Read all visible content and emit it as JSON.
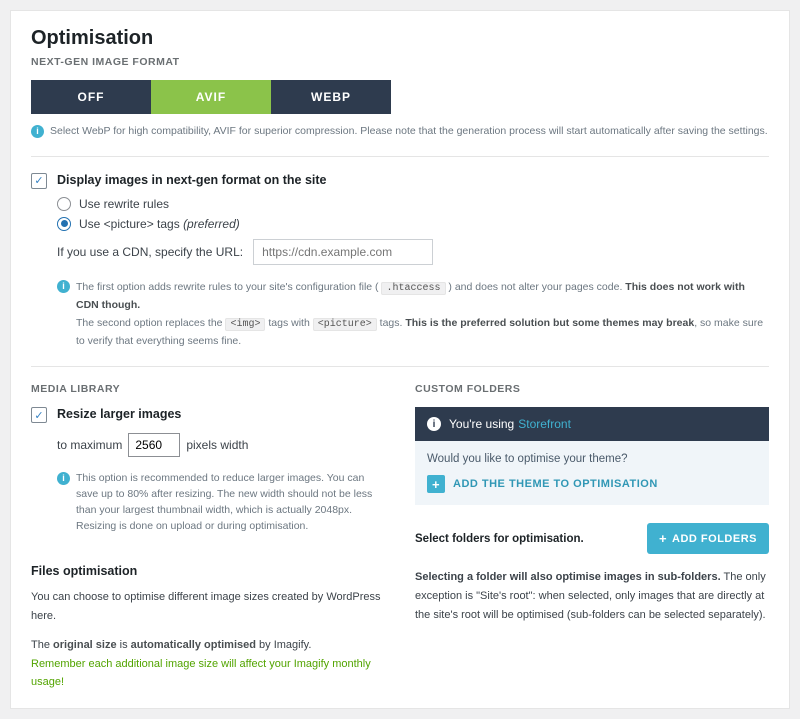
{
  "header": {
    "title": "Optimisation",
    "section": "NEXT-GEN IMAGE FORMAT"
  },
  "tabs": {
    "off": "OFF",
    "avif": "AVIF",
    "webp": "WEBP"
  },
  "format_info": "Select WebP for high compatibility, AVIF for superior compression. Please note that the generation process will start automatically after saving the settings.",
  "display": {
    "label": "Display images in next-gen format on the site",
    "radio_rewrite": "Use rewrite rules",
    "radio_picture_pre": "Use <picture> tags ",
    "radio_picture_suf": "(preferred)",
    "cdn_label": "If you use a CDN, specify the URL:",
    "cdn_placeholder": "https://cdn.example.com",
    "note1_a": "The first option adds rewrite rules to your site's configuration file ( ",
    "note1_code": ".htaccess",
    "note1_b": " ) and does not alter your pages code. ",
    "note1_bold": "This does not work with CDN though.",
    "note2_a": "The second option replaces the ",
    "note2_code1": "<img>",
    "note2_b": " tags with ",
    "note2_code2": "<picture>",
    "note2_c": " tags. ",
    "note2_bold": "This is the preferred solution but some themes may break",
    "note2_d": ", so make sure to verify that everything seems fine."
  },
  "media": {
    "section": "MEDIA LIBRARY",
    "resize_label": "Resize larger images",
    "to_max": "to maximum",
    "value": "2560",
    "unit": "pixels width",
    "note": "This option is recommended to reduce larger images. You can save up to 80% after resizing. The new width should not be less than your largest thumbnail width, which is actually 2048px. Resizing is done on upload or during optimisation.",
    "files_h": "Files optimisation",
    "files_p1": "You can choose to optimise different image sizes created by WordPress here.",
    "files_p2a": "The ",
    "files_p2b": "original size",
    "files_p2c": " is ",
    "files_p2d": "automatically optimised",
    "files_p2e": " by Imagify.",
    "files_warn": "Remember each additional image size will affect your Imagify monthly usage!"
  },
  "custom": {
    "section": "CUSTOM FOLDERS",
    "using": "You're using",
    "theme": "Storefront",
    "question": "Would you like to optimise your theme?",
    "add_theme": "ADD THE THEME TO OPTIMISATION",
    "select_label": "Select folders for optimisation.",
    "add_folders": "ADD FOLDERS",
    "desc_a": "Selecting a folder will also optimise images in sub-folders.",
    "desc_b": " The only exception is \"Site's root\": when selected, only images that are directly at the site's root will be optimised (sub-folders can be selected separately)."
  }
}
